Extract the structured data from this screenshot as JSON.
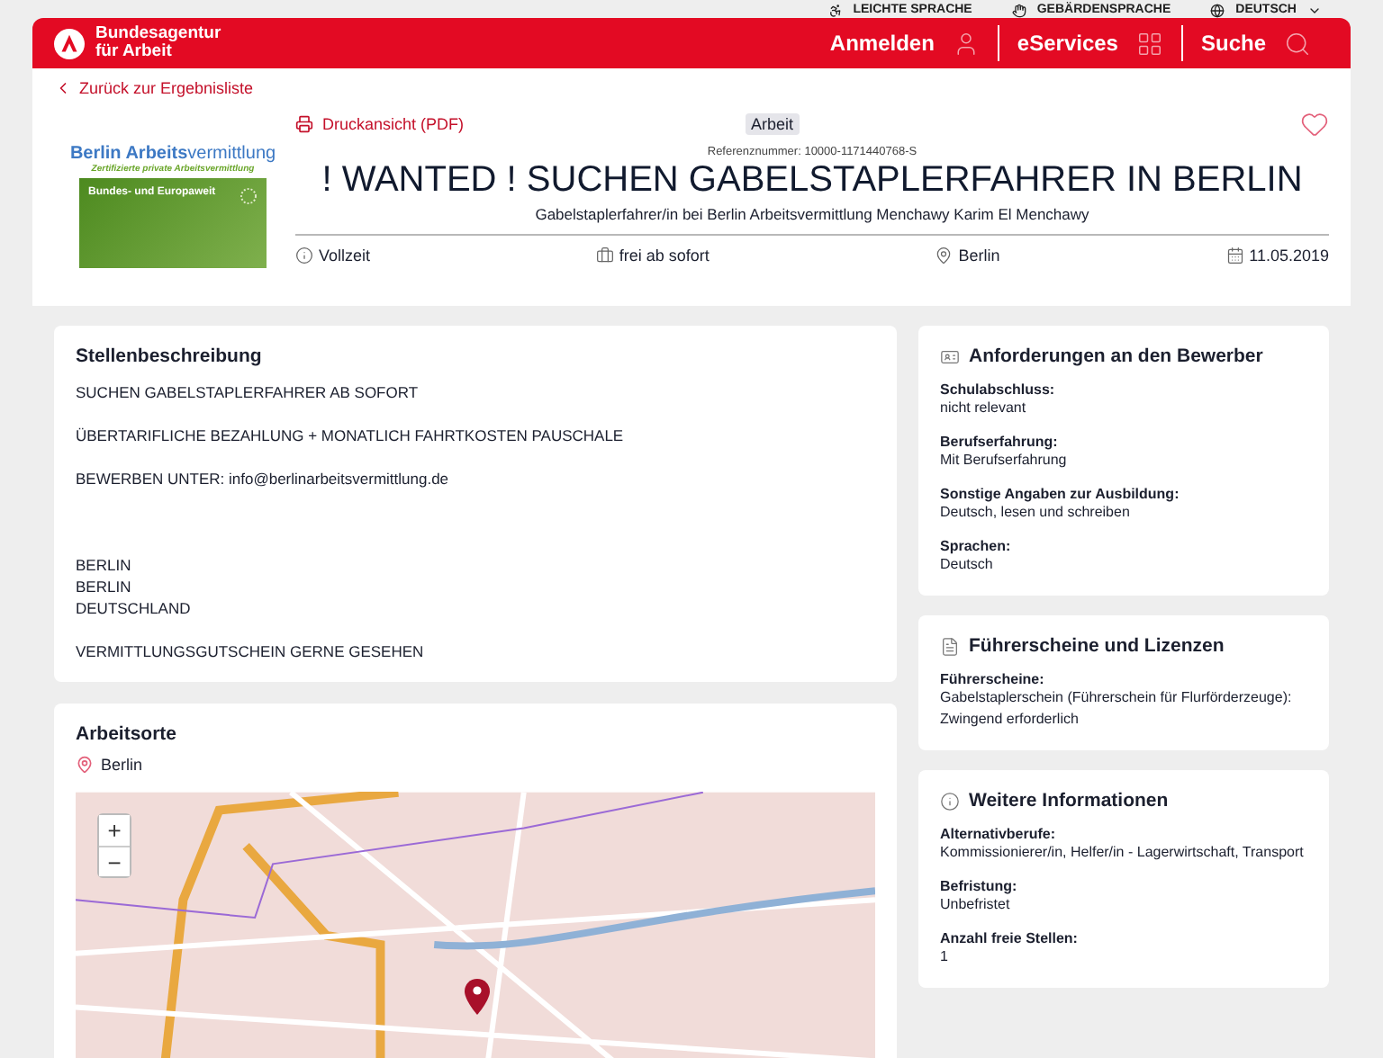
{
  "utility_links": [
    {
      "label": "LEICHTE SPRACHE",
      "kind": "easy"
    },
    {
      "label": "GEBÄRDENSPRACHE",
      "kind": "sign"
    },
    {
      "label": "DEUTSCH",
      "kind": "language"
    }
  ],
  "header": {
    "brand_lines": [
      "Bundesagentur",
      "für Arbeit"
    ],
    "nav": [
      {
        "label": "Anmelden",
        "kind": "login"
      },
      {
        "label": "eServices",
        "kind": "services"
      },
      {
        "label": "Suche",
        "kind": "search"
      }
    ]
  },
  "back_link": "Zurück zur Ergebnisliste",
  "company_logo": {
    "name_part1": "Berlin Arbeits",
    "name_part2": "vermittlung",
    "tagline": "Zertifizierte private Arbeitsvermittlung",
    "banner": "Bundes- und Europaweit"
  },
  "print_link": "Druckansicht (PDF)",
  "category": "Arbeit",
  "favorite": {
    "selected": false
  },
  "reference": "Referenznummer: 10000-1171440768-S",
  "title": "! WANTED ! SUCHEN GABELSTAPLERFAHRER IN BERLIN",
  "subtitle": "Gabelstaplerfahrer/in bei Berlin Arbeitsvermittlung Menchawy Karim El Menchawy",
  "facts": [
    {
      "kind": "info",
      "label": "Vollzeit"
    },
    {
      "kind": "start",
      "label": "frei ab sofort"
    },
    {
      "kind": "place",
      "label": "Berlin"
    },
    {
      "kind": "date",
      "label": "11.05.2019"
    }
  ],
  "description": {
    "heading": "Stellenbeschreibung",
    "paragraphs": [
      [
        "SUCHEN GABELSTAPLERFAHRER  AB SOFORT"
      ],
      [
        "ÜBERTARIFLICHE BEZAHLUNG + MONATLICH FAHRTKOSTEN PAUSCHALE"
      ],
      [
        "BEWERBEN UNTER: info@berlinarbeitsvermittlung.de"
      ],
      [
        "BERLIN",
        "BERLIN",
        "DEUTSCHLAND"
      ],
      [
        "VERMITTLUNGSGUTSCHEIN GERNE GESEHEN"
      ]
    ]
  },
  "locations": {
    "heading": "Arbeitsorte",
    "place": "Berlin",
    "map": {
      "zoom_in": "+",
      "zoom_out": "−"
    }
  },
  "side_cards": [
    {
      "kind": "requirements",
      "heading": "Anforderungen an den Bewerber",
      "fields": [
        {
          "label": "Schulabschluss:",
          "value": "nicht relevant"
        },
        {
          "label": "Berufserfahrung:",
          "value": "Mit Berufserfahrung"
        },
        {
          "label": "Sonstige Angaben zur Ausbildung:",
          "value": "Deutsch, lesen und schreiben"
        },
        {
          "label": "Sprachen:",
          "value": "Deutsch"
        }
      ]
    },
    {
      "kind": "licenses",
      "heading": "Führerscheine und Lizenzen",
      "fields": [
        {
          "label": "Führerscheine:",
          "value": "Gabelstaplerschein (Führerschein für Flurförderzeuge): Zwingend erforderlich"
        }
      ]
    },
    {
      "kind": "info",
      "heading": "Weitere Informationen",
      "fields": [
        {
          "label": "Alternativberufe:",
          "value": "Kommissionierer/in, Helfer/in - Lagerwirtschaft, Transport"
        },
        {
          "label": "Befristung:",
          "value": "Unbefristet"
        },
        {
          "label": "Anzahl freie Stellen:",
          "value": "1"
        }
      ]
    }
  ]
}
